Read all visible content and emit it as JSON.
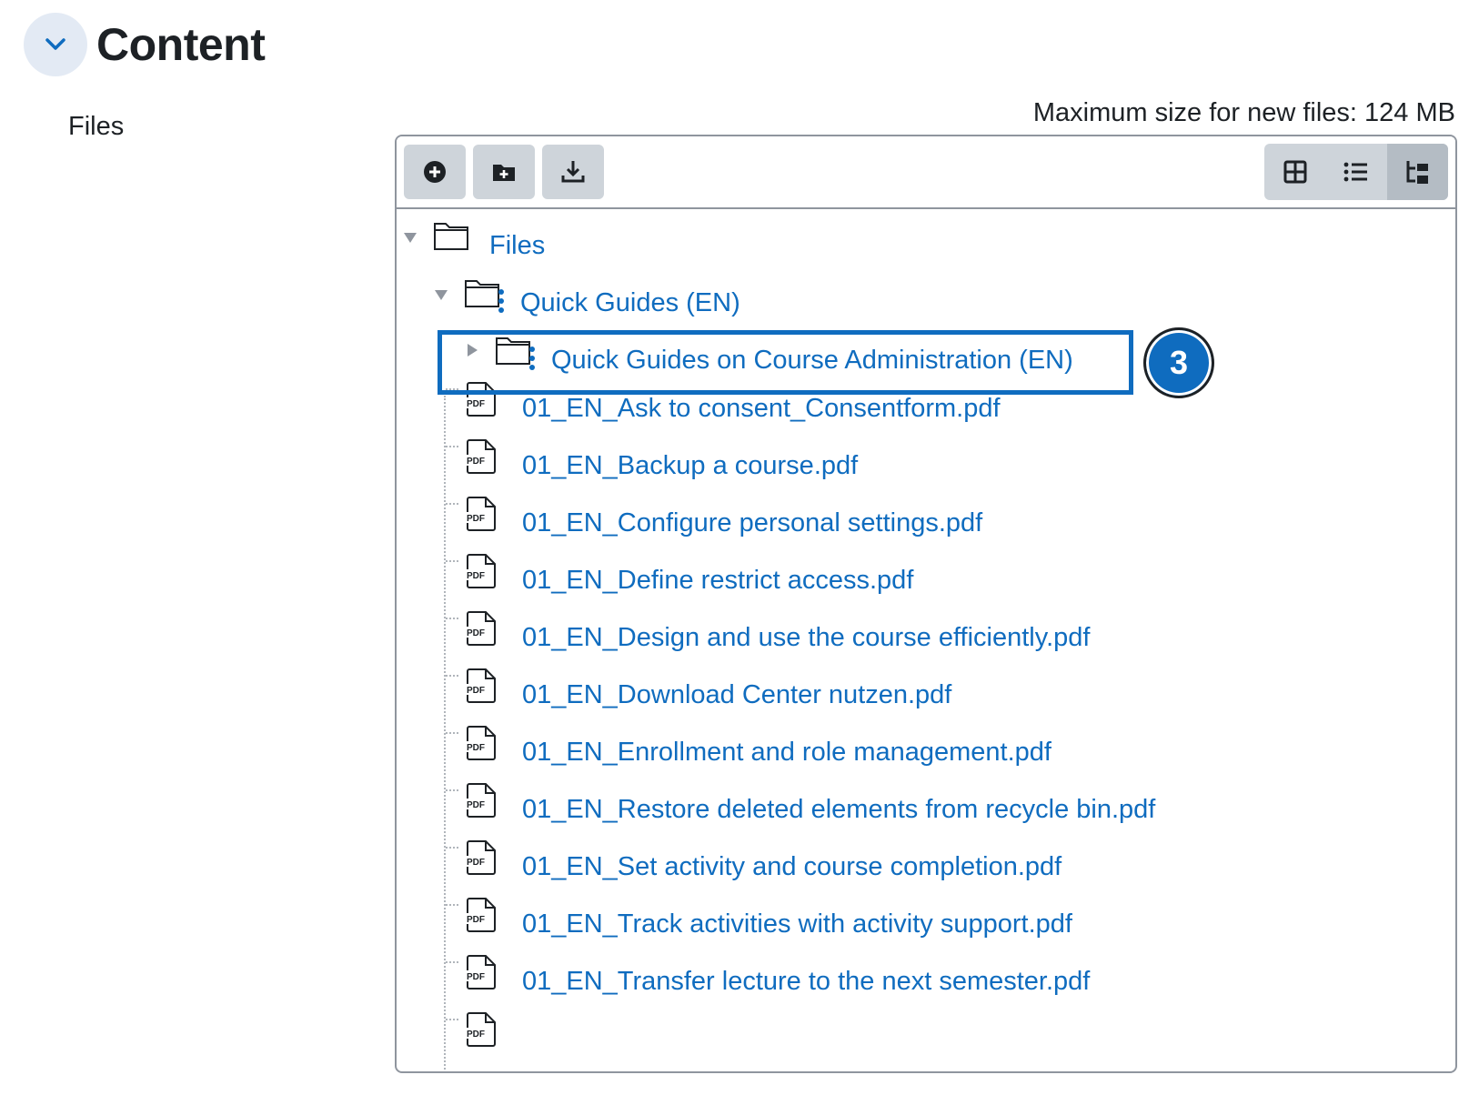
{
  "section": {
    "title": "Content",
    "collapse_icon": "chevron-down-icon"
  },
  "field": {
    "label": "Files"
  },
  "max_size": "Maximum size for new files: 124 MB",
  "toolbar": {
    "add_icon": "add-file-icon",
    "folder_icon": "create-folder-icon",
    "download_icon": "download-icon",
    "views": [
      "grid-view-icon",
      "list-view-icon",
      "tree-view-icon"
    ],
    "active_view": "tree-view-icon"
  },
  "tree": {
    "root": "Files",
    "subfolder": "Quick Guides (EN)",
    "nested_folder": "Quick Guides on Course Administration (EN)",
    "pdf_icon_text": "PDF",
    "files": [
      "01_EN_Ask to consent_Consentform.pdf",
      "01_EN_Backup a course.pdf",
      "01_EN_Configure personal settings.pdf",
      "01_EN_Define restrict access.pdf",
      "01_EN_Design and use the course efficiently.pdf",
      "01_EN_Download Center nutzen.pdf",
      "01_EN_Enrollment and role management.pdf",
      "01_EN_Restore deleted elements from recycle bin.pdf",
      "01_EN_Set activity and course completion.pdf",
      "01_EN_Track activities with activity support.pdf",
      "01_EN_Transfer lecture to the next semester.pdf"
    ]
  },
  "annotation": {
    "step": "3"
  },
  "colors": {
    "link": "#0f6cbf",
    "toolbar_button": "#ced4da",
    "highlight": "#0f6cbf"
  }
}
